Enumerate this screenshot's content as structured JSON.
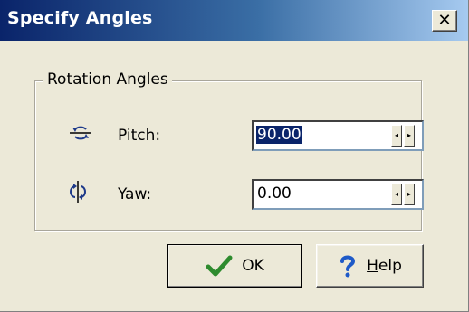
{
  "window": {
    "title": "Specify Angles",
    "close_glyph": "✕"
  },
  "group": {
    "label": "Rotation Angles"
  },
  "rows": [
    {
      "label": "Pitch:",
      "icon": "pitch-rotation-icon",
      "value": "90.00",
      "selected": true
    },
    {
      "label": "Yaw:",
      "icon": "yaw-rotation-icon",
      "value": "0.00",
      "selected": false
    }
  ],
  "spin": {
    "left_glyph": "◂",
    "right_glyph": "▸"
  },
  "buttons": {
    "ok_label": "OK",
    "ok_icon": "checkmark-icon",
    "help_first_letter": "H",
    "help_rest": "elp",
    "help_icon": "question-mark-icon"
  },
  "colors": {
    "title_bar_start": "#0a246a",
    "title_bar_end": "#a6caf0",
    "dialog_bg": "#ece9d8",
    "selection": "#0a246a",
    "check_green": "#2e8b2e",
    "help_blue": "#1e5ac8"
  }
}
